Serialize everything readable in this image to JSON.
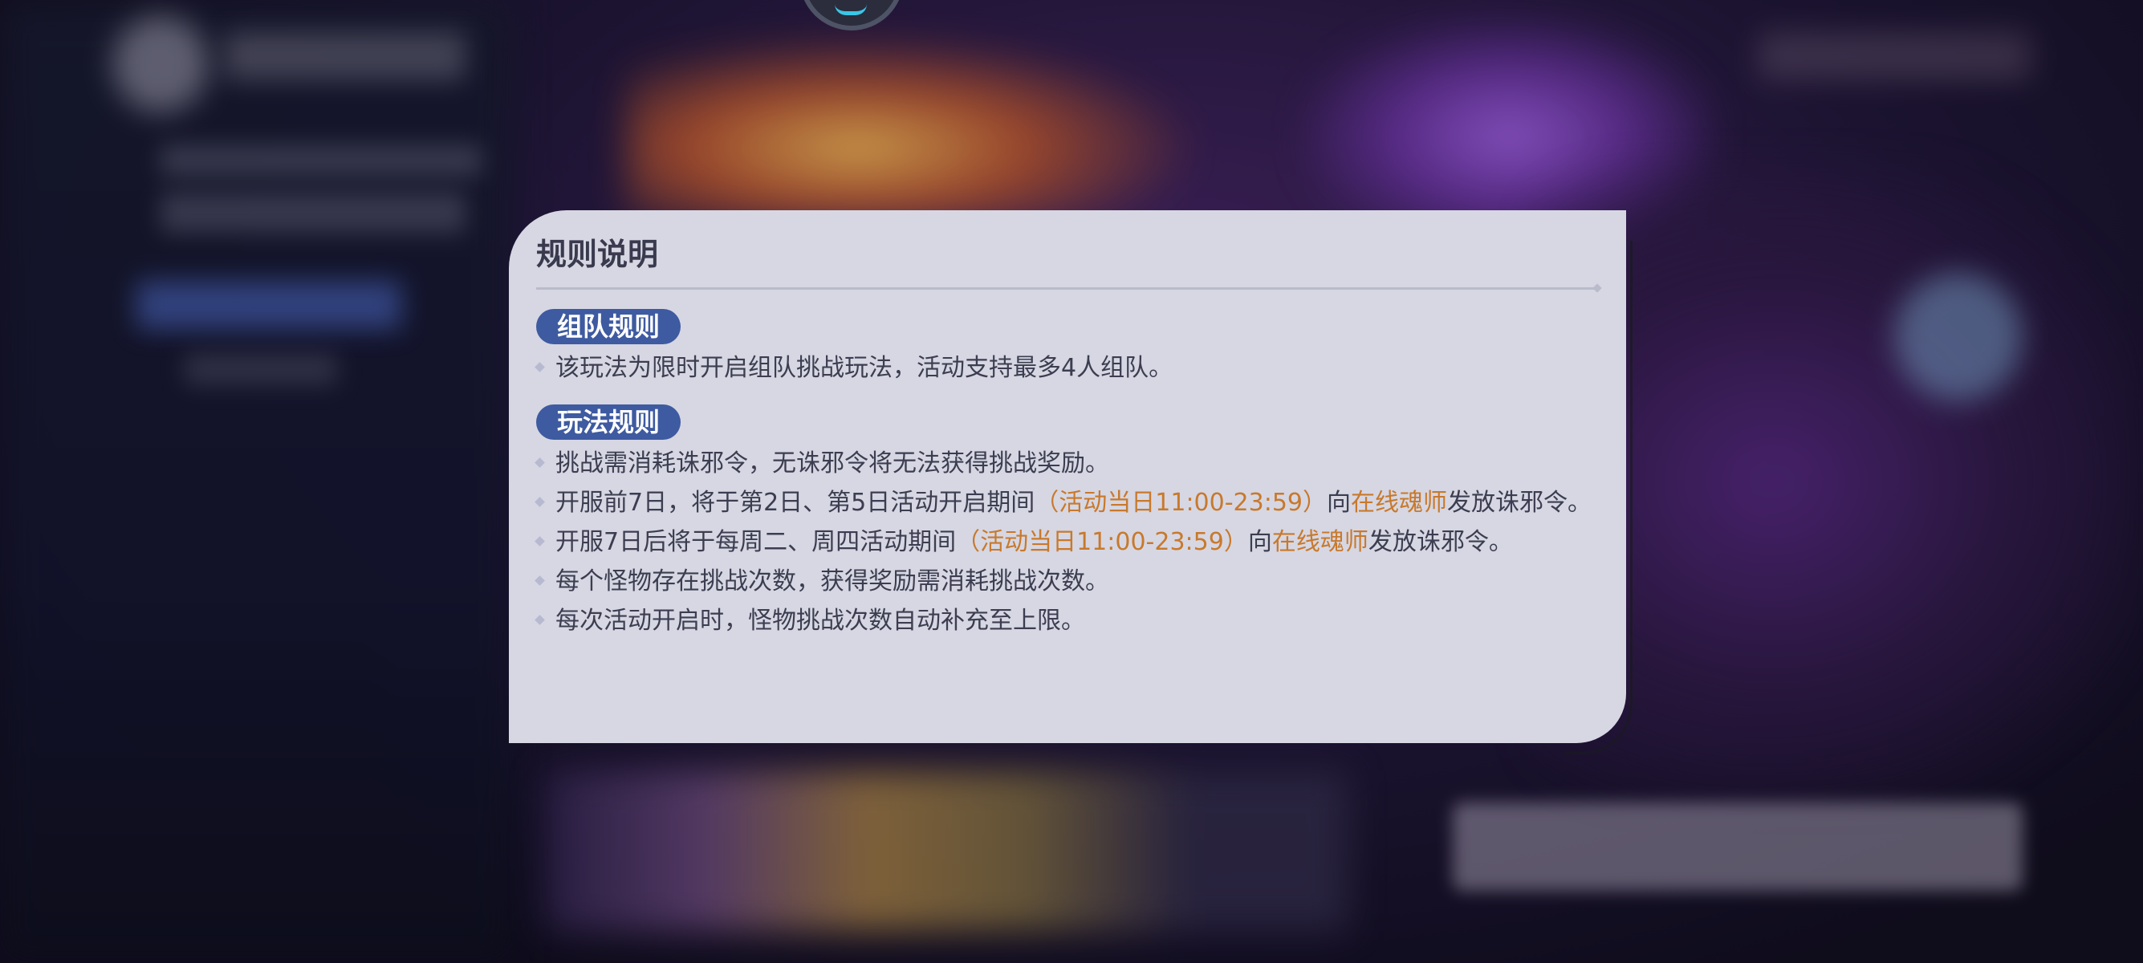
{
  "dialog": {
    "title": "规则说明",
    "sections": [
      {
        "tag": "组队规则",
        "items": [
          {
            "segments": [
              {
                "text": "该玩法为限时开启组队挑战玩法，活动支持最多4人组队。",
                "highlight": false
              }
            ]
          }
        ]
      },
      {
        "tag": "玩法规则",
        "items": [
          {
            "segments": [
              {
                "text": "挑战需消耗诛邪令，无诛邪令将无法获得挑战奖励。",
                "highlight": false
              }
            ]
          },
          {
            "segments": [
              {
                "text": "开服前7日，将于第2日、第5日活动开启期间",
                "highlight": false
              },
              {
                "text": "（活动当日11:00-23:59）",
                "highlight": true
              },
              {
                "text": "向",
                "highlight": false
              },
              {
                "text": "在线魂师",
                "highlight": true
              },
              {
                "text": "发放诛邪令。",
                "highlight": false
              }
            ]
          },
          {
            "segments": [
              {
                "text": "开服7日后将于每周二、周四活动期间",
                "highlight": false
              },
              {
                "text": "（活动当日11:00-23:59）",
                "highlight": true
              },
              {
                "text": "向",
                "highlight": false
              },
              {
                "text": "在线魂师",
                "highlight": true
              },
              {
                "text": "发放诛邪令。",
                "highlight": false
              }
            ]
          },
          {
            "segments": [
              {
                "text": "每个怪物存在挑战次数，获得奖励需消耗挑战次数。",
                "highlight": false
              }
            ]
          },
          {
            "segments": [
              {
                "text": "每次活动开启时，怪物挑战次数自动补充至上限。",
                "highlight": false
              }
            ]
          }
        ]
      }
    ]
  },
  "colors": {
    "panel_bg": "#d6d7e3",
    "tag_bg": "#3e5aa0",
    "highlight": "#c8792c",
    "text": "#3c3d50",
    "spinner": "#39c6e6"
  },
  "icons": {
    "loading": "loading-spinner-icon",
    "bullet": "diamond-bullet-icon"
  }
}
